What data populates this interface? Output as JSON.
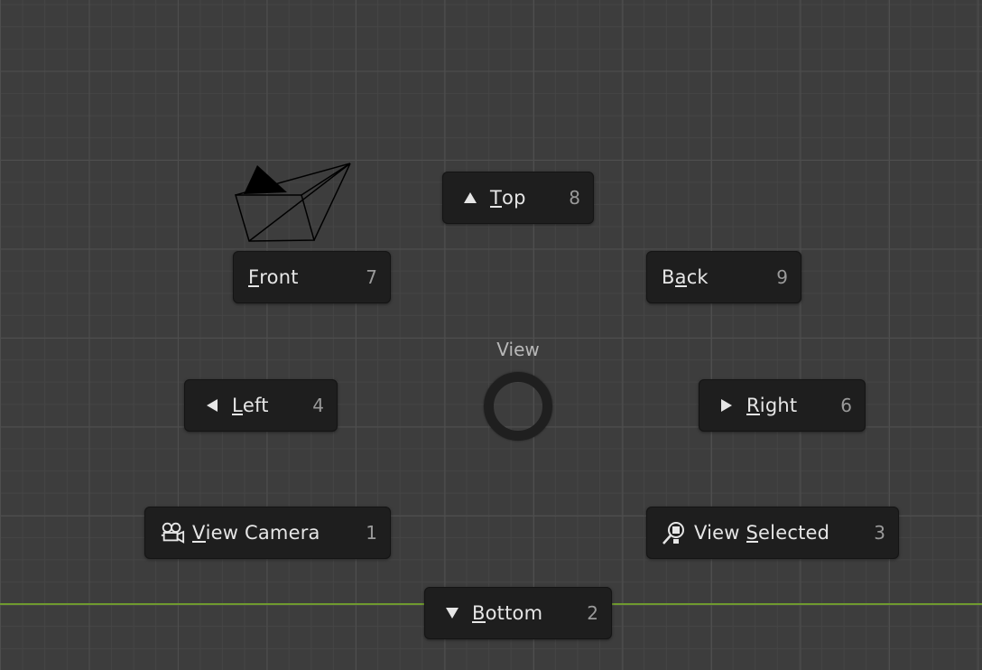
{
  "pie_menu": {
    "title": "View",
    "buttons": {
      "top": {
        "pre": "",
        "accel": "T",
        "post": "op",
        "key": "8",
        "icon": "triangle-up-icon"
      },
      "front": {
        "pre": "",
        "accel": "F",
        "post": "ront",
        "key": "7",
        "icon": ""
      },
      "back": {
        "pre": "B",
        "accel": "a",
        "post": "ck",
        "key": "9",
        "icon": ""
      },
      "left": {
        "pre": "",
        "accel": "L",
        "post": "eft",
        "key": "4",
        "icon": "triangle-left-icon"
      },
      "right": {
        "pre": "",
        "accel": "R",
        "post": "ight",
        "key": "6",
        "icon": "triangle-right-icon"
      },
      "view_camera": {
        "pre": "",
        "accel": "V",
        "post": "iew Camera",
        "key": "1",
        "icon": "camera-icon"
      },
      "view_selected": {
        "pre": "View ",
        "accel": "S",
        "post": "elected",
        "key": "3",
        "icon": "zoom-selected-icon"
      },
      "bottom": {
        "pre": "",
        "accel": "B",
        "post": "ottom",
        "key": "2",
        "icon": "triangle-down-icon"
      }
    }
  },
  "colors": {
    "viewport_bg": "#3d3d3d",
    "grid_line": "#4e4e4e",
    "x_axis": "#6f9a2f",
    "button_bg": "#1e1e1e",
    "button_text": "#e6e6e6",
    "shortcut_text": "#9a9a9a"
  }
}
